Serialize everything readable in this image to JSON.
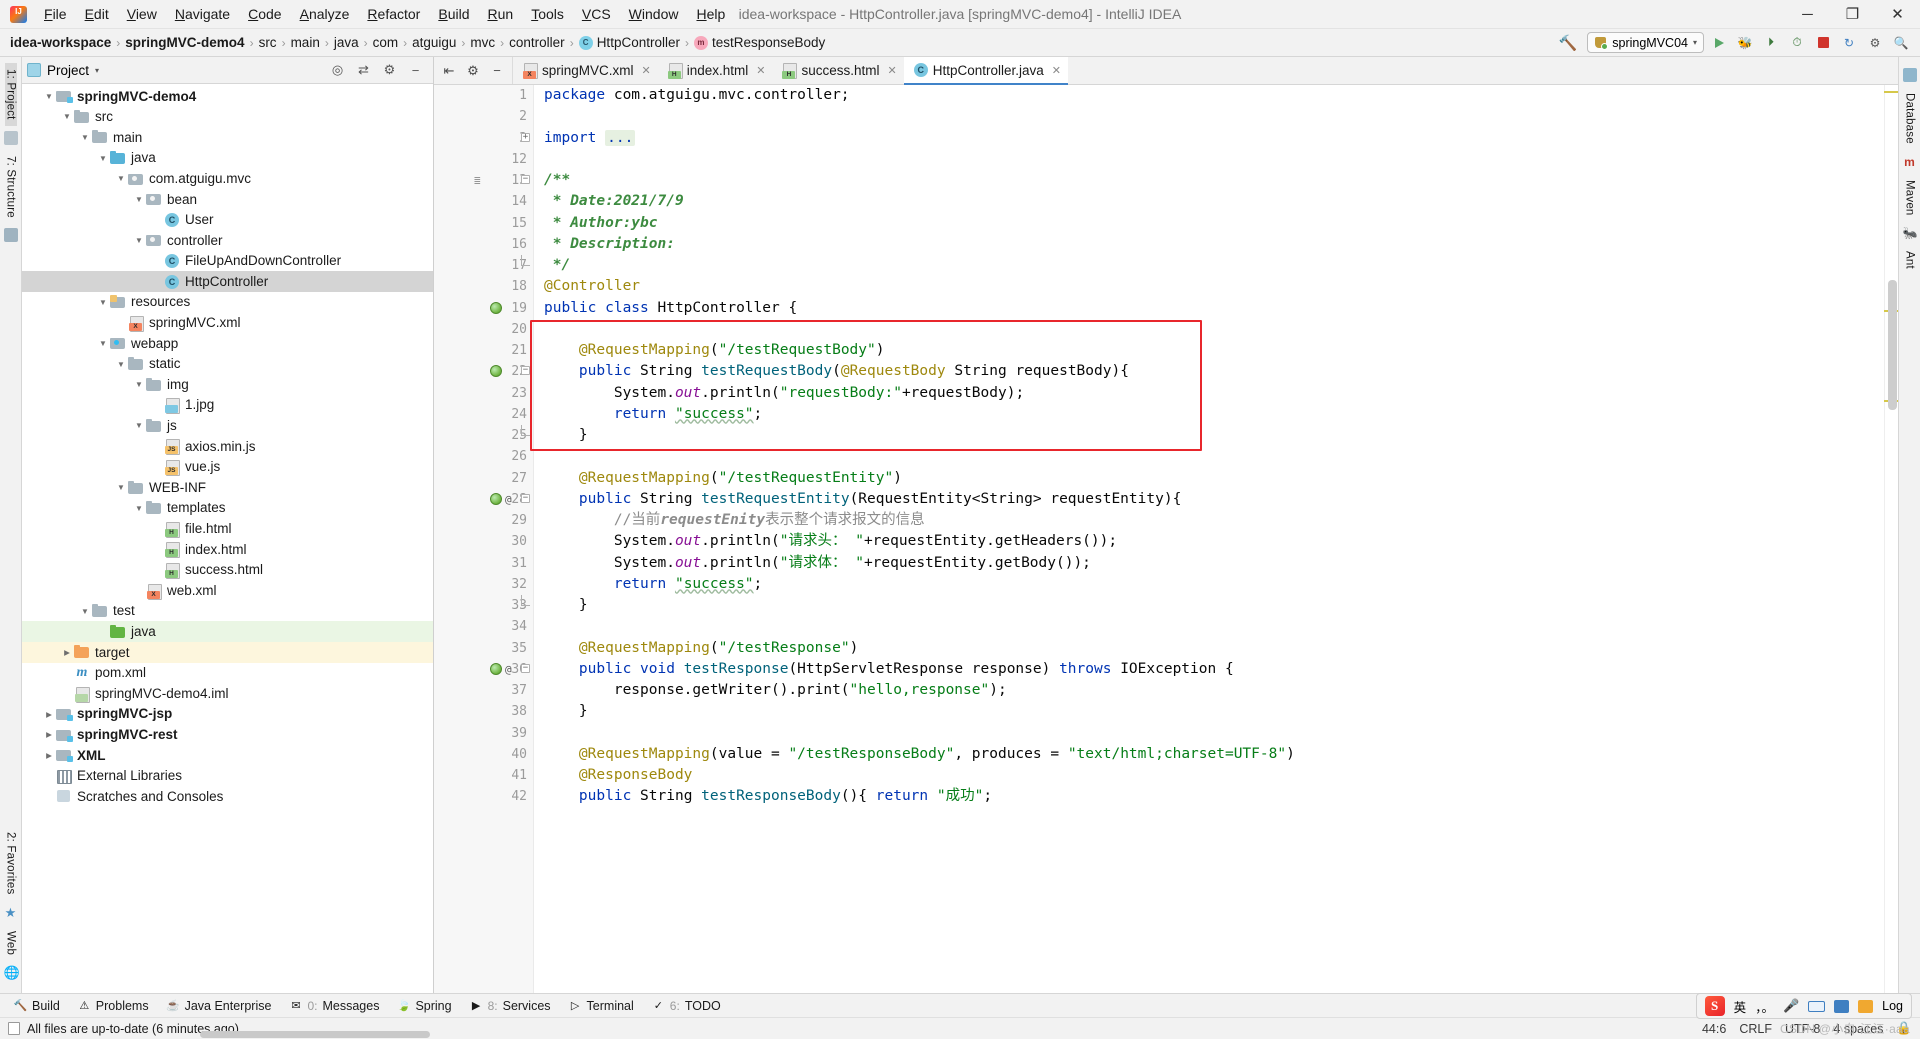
{
  "window": {
    "title": "idea-workspace - HttpController.java [springMVC-demo4] - IntelliJ IDEA",
    "minimize": "─",
    "maximize": "❐",
    "close": "✕"
  },
  "menubar": {
    "logo": "idea-logo",
    "items": [
      "File",
      "Edit",
      "View",
      "Navigate",
      "Code",
      "Analyze",
      "Refactor",
      "Build",
      "Run",
      "Tools",
      "VCS",
      "Window",
      "Help"
    ]
  },
  "breadcrumb": {
    "items": [
      {
        "label": "idea-workspace",
        "bold": true,
        "icon": null
      },
      {
        "label": "springMVC-demo4",
        "bold": true,
        "icon": null
      },
      {
        "label": "src",
        "bold": false,
        "icon": null
      },
      {
        "label": "main",
        "bold": false,
        "icon": null
      },
      {
        "label": "java",
        "bold": false,
        "icon": null
      },
      {
        "label": "com",
        "bold": false,
        "icon": null
      },
      {
        "label": "atguigu",
        "bold": false,
        "icon": null
      },
      {
        "label": "mvc",
        "bold": false,
        "icon": null
      },
      {
        "label": "controller",
        "bold": false,
        "icon": null
      },
      {
        "label": "HttpController",
        "bold": false,
        "icon": "class-icon",
        "glyph": "C"
      },
      {
        "label": "testResponseBody",
        "bold": false,
        "icon": "method-icon",
        "glyph": "m"
      }
    ],
    "separator": "›"
  },
  "toolbar": {
    "build_hammer": "hammer-icon",
    "run_config": "springMVC04",
    "run_label": "run-button",
    "debug_label": "debug-button",
    "coverage_label": "run-with-coverage-button",
    "profiler_label": "profiler-button",
    "stop_label": "stop-button",
    "updates_label": "update-project-button",
    "settings_label": "settings-button",
    "search_label": "search-everywhere-button",
    "chevron": "▾"
  },
  "project_panel": {
    "title": "Project",
    "title_chevron": "▾",
    "icons": [
      "locate-icon",
      "collapse-all-icon",
      "settings-gear-icon",
      "hide-icon"
    ],
    "tree": [
      {
        "indent": 0,
        "arrow": "down",
        "icon": "f-mod",
        "label": "springMVC-demo4",
        "bold": true,
        "state": ""
      },
      {
        "indent": 1,
        "arrow": "down",
        "icon": "f-grey",
        "label": "src",
        "bold": false,
        "state": ""
      },
      {
        "indent": 2,
        "arrow": "down",
        "icon": "f-grey",
        "label": "main",
        "bold": false,
        "state": ""
      },
      {
        "indent": 3,
        "arrow": "down",
        "icon": "f-blue",
        "label": "java",
        "bold": false,
        "state": ""
      },
      {
        "indent": 4,
        "arrow": "down",
        "icon": "f-grey f-pkg",
        "label": "com.atguigu.mvc",
        "bold": false,
        "state": ""
      },
      {
        "indent": 5,
        "arrow": "down",
        "icon": "f-grey f-pkg",
        "label": "bean",
        "bold": false,
        "state": ""
      },
      {
        "indent": 6,
        "arrow": "",
        "icon": "i-class",
        "label": "User",
        "bold": false,
        "state": ""
      },
      {
        "indent": 5,
        "arrow": "down",
        "icon": "f-grey f-pkg",
        "label": "controller",
        "bold": false,
        "state": ""
      },
      {
        "indent": 6,
        "arrow": "",
        "icon": "i-class",
        "label": "FileUpAndDownController",
        "bold": false,
        "state": ""
      },
      {
        "indent": 6,
        "arrow": "",
        "icon": "i-class",
        "label": "HttpController",
        "bold": false,
        "state": "sel"
      },
      {
        "indent": 3,
        "arrow": "down",
        "icon": "f-grey f-src",
        "label": "resources",
        "bold": false,
        "state": ""
      },
      {
        "indent": 4,
        "arrow": "",
        "icon": "i-file i-xml",
        "badge": "X",
        "label": "springMVC.xml",
        "bold": false,
        "state": ""
      },
      {
        "indent": 3,
        "arrow": "down",
        "icon": "f-grey f-web",
        "label": "webapp",
        "bold": false,
        "state": ""
      },
      {
        "indent": 4,
        "arrow": "down",
        "icon": "f-grey",
        "label": "static",
        "bold": false,
        "state": ""
      },
      {
        "indent": 5,
        "arrow": "down",
        "icon": "f-grey",
        "label": "img",
        "bold": false,
        "state": ""
      },
      {
        "indent": 6,
        "arrow": "",
        "icon": "i-file i-img",
        "badge": "",
        "label": "1.jpg",
        "bold": false,
        "state": ""
      },
      {
        "indent": 5,
        "arrow": "down",
        "icon": "f-grey",
        "label": "js",
        "bold": false,
        "state": ""
      },
      {
        "indent": 6,
        "arrow": "",
        "icon": "i-file i-js",
        "badge": "JS",
        "label": "axios.min.js",
        "bold": false,
        "state": ""
      },
      {
        "indent": 6,
        "arrow": "",
        "icon": "i-file i-js",
        "badge": "JS",
        "label": "vue.js",
        "bold": false,
        "state": ""
      },
      {
        "indent": 4,
        "arrow": "down",
        "icon": "f-grey",
        "label": "WEB-INF",
        "bold": false,
        "state": ""
      },
      {
        "indent": 5,
        "arrow": "down",
        "icon": "f-grey",
        "label": "templates",
        "bold": false,
        "state": ""
      },
      {
        "indent": 6,
        "arrow": "",
        "icon": "i-file i-html",
        "badge": "H",
        "label": "file.html",
        "bold": false,
        "state": ""
      },
      {
        "indent": 6,
        "arrow": "",
        "icon": "i-file i-html",
        "badge": "H",
        "label": "index.html",
        "bold": false,
        "state": ""
      },
      {
        "indent": 6,
        "arrow": "",
        "icon": "i-file i-html",
        "badge": "H",
        "label": "success.html",
        "bold": false,
        "state": ""
      },
      {
        "indent": 5,
        "arrow": "",
        "icon": "i-file i-xml",
        "badge": "X",
        "label": "web.xml",
        "bold": false,
        "state": ""
      },
      {
        "indent": 2,
        "arrow": "down",
        "icon": "f-grey",
        "label": "test",
        "bold": false,
        "state": ""
      },
      {
        "indent": 3,
        "arrow": "",
        "icon": "f-green",
        "label": "java",
        "bold": false,
        "state": "green"
      },
      {
        "indent": 1,
        "arrow": "right",
        "icon": "f-orange",
        "label": "target",
        "bold": false,
        "state": "yellow"
      },
      {
        "indent": 1,
        "arrow": "",
        "icon": "i-m",
        "label": "pom.xml",
        "bold": false,
        "state": ""
      },
      {
        "indent": 1,
        "arrow": "",
        "icon": "i-file",
        "badge": "",
        "label": "springMVC-demo4.iml",
        "bold": false,
        "state": ""
      },
      {
        "indent": 0,
        "arrow": "right",
        "icon": "f-mod",
        "label": "springMVC-jsp",
        "bold": true,
        "state": ""
      },
      {
        "indent": 0,
        "arrow": "right",
        "icon": "f-mod",
        "label": "springMVC-rest",
        "bold": true,
        "state": ""
      },
      {
        "indent": 0,
        "arrow": "right",
        "icon": "f-mod",
        "label": "XML",
        "bold": true,
        "state": ""
      },
      {
        "indent": 0,
        "arrow": "",
        "icon": "i-lib",
        "label": "External Libraries",
        "bold": false,
        "state": ""
      },
      {
        "indent": 0,
        "arrow": "",
        "icon": "i-scratch",
        "label": "Scratches and Consoles",
        "bold": false,
        "state": ""
      }
    ]
  },
  "left_rail": {
    "items": [
      "1: Project",
      "7: Structure",
      "2: Favorites",
      "Web"
    ]
  },
  "right_rail": {
    "items": [
      "Database",
      "Maven",
      "Ant"
    ]
  },
  "editor": {
    "tab_tools": [
      "expand-collapse-icon",
      "settings-gear-icon",
      "hide-panel-icon"
    ],
    "tabs": [
      {
        "label": "springMVC.xml",
        "icon": "xml-file-icon",
        "active": false,
        "close": "✕"
      },
      {
        "label": "index.html",
        "icon": "html-file-icon",
        "active": false,
        "close": "✕"
      },
      {
        "label": "success.html",
        "icon": "html-file-icon",
        "active": false,
        "close": "✕"
      },
      {
        "label": "HttpController.java",
        "icon": "java-class-icon",
        "active": true,
        "close": "✕"
      }
    ],
    "line_numbers": [
      1,
      2,
      3,
      12,
      13,
      14,
      15,
      16,
      17,
      18,
      19,
      20,
      21,
      22,
      23,
      24,
      25,
      26,
      27,
      28,
      29,
      30,
      31,
      32,
      33,
      34,
      35,
      36,
      37,
      38,
      39,
      40,
      41,
      42
    ],
    "code_lines": [
      {
        "n": 1,
        "html": "<span class='kw'>package</span> com.atguigu.mvc.controller;"
      },
      {
        "n": 2,
        "html": ""
      },
      {
        "n": 3,
        "html": "<span class='kw'>import</span> <span class='folded'>...</span>"
      },
      {
        "n": 12,
        "html": ""
      },
      {
        "n": 13,
        "html": "<span class='jdoc-b'>/**</span>"
      },
      {
        "n": 14,
        "html": "<span class='jdoc-b'> * Date:2021/7/9</span>"
      },
      {
        "n": 15,
        "html": "<span class='jdoc-b'> * Author:ybc</span>"
      },
      {
        "n": 16,
        "html": "<span class='jdoc-b'> * Description:</span>"
      },
      {
        "n": 17,
        "html": "<span class='jdoc-b'> */</span>"
      },
      {
        "n": 18,
        "html": "<span class='ann'>@Controller</span>"
      },
      {
        "n": 19,
        "html": "<span class='kw'>public class</span> HttpController {"
      },
      {
        "n": 20,
        "html": ""
      },
      {
        "n": 21,
        "html": "    <span class='ann'>@RequestMapping</span>(<span class='str'>\"/testRequestBody\"</span>)"
      },
      {
        "n": 22,
        "html": "    <span class='kw'>public</span> String <span class='mth'>testRequestBody</span>(<span class='ann'>@RequestBody</span> String requestBody){"
      },
      {
        "n": 23,
        "html": "        System.<span class='fld'>out</span>.println(<span class='str'>\"requestBody:\"</span>+requestBody);"
      },
      {
        "n": 24,
        "html": "        <span class='kw'>return</span> <span class='strwave'>\"success\"</span>;"
      },
      {
        "n": 25,
        "html": "    }"
      },
      {
        "n": 26,
        "html": ""
      },
      {
        "n": 27,
        "html": "    <span class='ann'>@RequestMapping</span>(<span class='str'>\"/testRequestEntity\"</span>)"
      },
      {
        "n": 28,
        "html": "    <span class='kw'>public</span> String <span class='mth'>testRequestEntity</span>(RequestEntity&lt;String&gt; requestEntity){"
      },
      {
        "n": 29,
        "html": "        <span class='cmt'>//当前<b><i>requestEnity</i></b>表示整个请求报文的信息</span>"
      },
      {
        "n": 30,
        "html": "        System.<span class='fld'>out</span>.println(<span class='str'>\"请求头： \"</span>+requestEntity.getHeaders());"
      },
      {
        "n": 31,
        "html": "        System.<span class='fld'>out</span>.println(<span class='str'>\"请求体： \"</span>+requestEntity.getBody());"
      },
      {
        "n": 32,
        "html": "        <span class='kw'>return</span> <span class='strwave'>\"success\"</span>;"
      },
      {
        "n": 33,
        "html": "    }"
      },
      {
        "n": 34,
        "html": ""
      },
      {
        "n": 35,
        "html": "    <span class='ann'>@RequestMapping</span>(<span class='str'>\"/testResponse\"</span>)"
      },
      {
        "n": 36,
        "html": "    <span class='kw'>public void</span> <span class='mth'>testResponse</span>(HttpServletResponse response) <span class='kw'>throws</span> IOException {"
      },
      {
        "n": 37,
        "html": "        response.getWriter().print(<span class='str'>\"hello,response\"</span>);"
      },
      {
        "n": 38,
        "html": "    }"
      },
      {
        "n": 39,
        "html": ""
      },
      {
        "n": 40,
        "html": "    <span class='ann'>@RequestMapping</span>(value = <span class='str'>\"/testResponseBody\"</span>, produces = <span class='str'>\"text/html;charset=UTF-8\"</span>)"
      },
      {
        "n": 41,
        "html": "    <span class='ann'>@ResponseBody</span>"
      },
      {
        "n": 42,
        "html": "    <span class='kw'>public</span> String <span class='mth'>testResponseBody</span>(){ <span class='kw'>return</span> <span class='str'>\"成功\"</span>;"
      }
    ],
    "highlight_box": {
      "top_line": 20,
      "bottom_line": 26,
      "color": "#e8262c"
    }
  },
  "bottom_bar": {
    "items": [
      {
        "num": "",
        "label": "Build",
        "icon": "build-hammer-icon"
      },
      {
        "num": "",
        "label": "Problems",
        "icon": "warning-triangle-icon"
      },
      {
        "num": "",
        "label": "Java Enterprise",
        "icon": "java-enterprise-icon"
      },
      {
        "num": "0:",
        "label": "Messages",
        "icon": "messages-icon"
      },
      {
        "num": "",
        "label": "Spring",
        "icon": "spring-leaf-icon"
      },
      {
        "num": "8:",
        "label": "Services",
        "icon": "services-icon"
      },
      {
        "num": "",
        "label": "Terminal",
        "icon": "terminal-icon"
      },
      {
        "num": "6:",
        "label": "TODO",
        "icon": "todo-checklist-icon"
      }
    ]
  },
  "status_bar": {
    "message": "All files are up-to-date (6 minutes ago)",
    "caret": "44:6",
    "line_sep": "CRLF",
    "encoding": "UTF-8",
    "indent": "4 spaces",
    "lock": "lock-icon",
    "watermark": "CSDN @小白·江江·aaa"
  },
  "ime": {
    "logo": "S",
    "mode": "英",
    "punct": "，。",
    "mic": "mic-icon",
    "keyboard": "keyboard-icon",
    "toolbox": "toolbox-icon",
    "palette": "palette-icon",
    "log": "Log"
  },
  "colors": {
    "accent": "#4083c9",
    "highlight_red": "#e8262c",
    "keyword_blue": "#0033b3",
    "string_green": "#067d17",
    "annotation_gold": "#9e880d",
    "comment_grey": "#8c8c8c",
    "javadoc_green": "#3d8b40",
    "selection_grey": "#d4d4d4",
    "test_green": "#eaf6e4",
    "target_yellow": "#fdf6dd"
  }
}
